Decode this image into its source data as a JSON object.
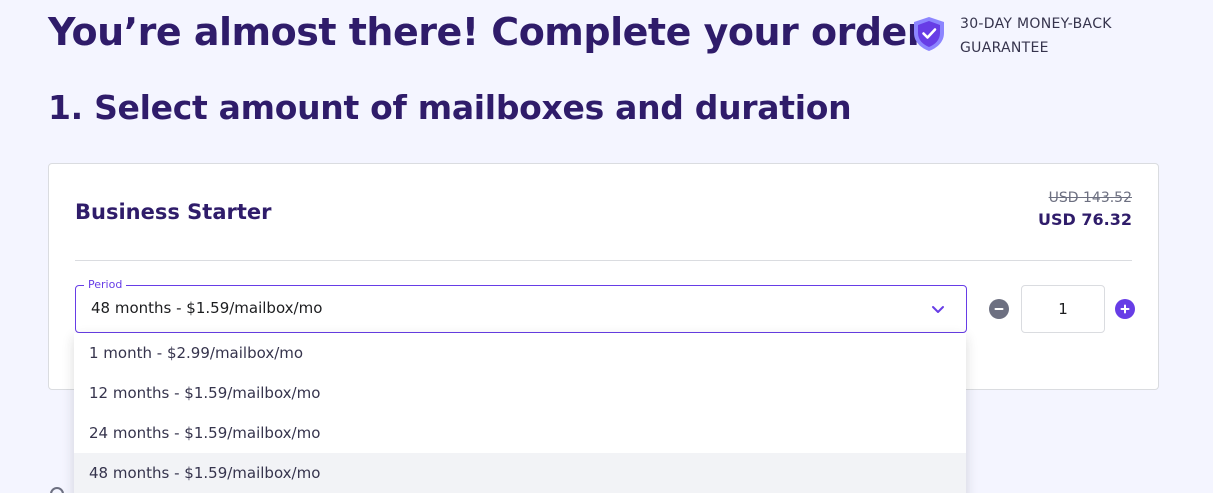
{
  "header": {
    "title": "You’re almost there! Complete your order",
    "guarantee_line1": "30-DAY MONEY-BACK",
    "guarantee_line2": "GUARANTEE"
  },
  "section": {
    "title": "1. Select amount of mailboxes and duration"
  },
  "plan": {
    "name": "Business Starter",
    "old_price": "USD 143.52",
    "new_price": "USD 76.32"
  },
  "period_select": {
    "label": "Period",
    "value": "48 months - $1.59/mailbox/mo",
    "options": [
      "1 month - $2.99/mailbox/mo",
      "12 months - $1.59/mailbox/mo",
      "24 months - $1.59/mailbox/mo",
      "48 months - $1.59/mailbox/mo"
    ]
  },
  "quantity": {
    "value": "1"
  },
  "colors": {
    "primary": "#673de6",
    "heading": "#2f1c6a",
    "background": "#f4f5ff"
  },
  "icons": {
    "guarantee": "shield-check-icon",
    "chevron": "chevron-down-icon",
    "minus": "minus-circle-icon",
    "plus": "plus-circle-icon"
  }
}
